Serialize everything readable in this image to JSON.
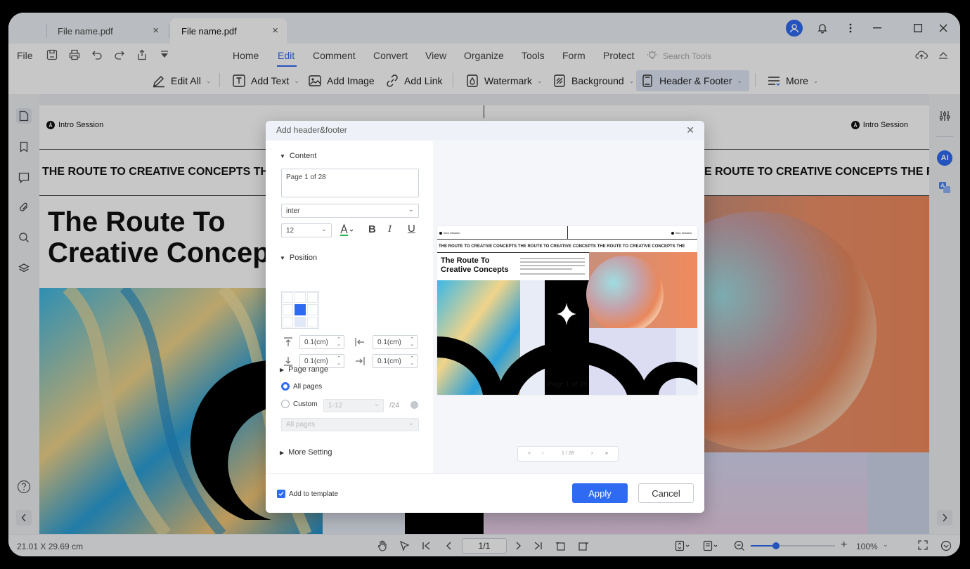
{
  "tabs": [
    {
      "title": "File name.pdf"
    },
    {
      "title": "File name.pdf"
    }
  ],
  "menu": {
    "file": "File",
    "items": [
      "Home",
      "Edit",
      "Comment",
      "Convert",
      "View",
      "Organize",
      "Tools",
      "Form",
      "Protect"
    ],
    "search_placeholder": "Search Tools"
  },
  "toolbar": {
    "edit_all": "Edit All",
    "add_text": "Add Text",
    "add_image": "Add Image",
    "add_link": "Add Link",
    "watermark": "Watermark",
    "background": "Background",
    "header_footer": "Header & Footer",
    "more": "More"
  },
  "doc": {
    "header_label": "Intro Session",
    "marquee": "THE ROUTE TO CREATIVE CONCEPTS THE ROUTE TO CREATIVE CONCEPTS",
    "marquee_right": "E ROUTE TO CREATIVE CONCEPTS THE R",
    "title_line1": "The Route To",
    "title_line2": "Creative Concep"
  },
  "dialog": {
    "title": "Add header&footer",
    "content_label": "Content",
    "content_text": "Page 1 of 28",
    "font": "inter",
    "font_size": "12",
    "position_label": "Position",
    "margin_top": "0.1(cm)",
    "margin_left": "0.1(cm)",
    "margin_bottom": "0.1(cm)",
    "margin_right": "0.1(cm)",
    "page_range_label": "Page range",
    "all_pages": "All pages",
    "custom": "Custom",
    "custom_range": "1-12",
    "total_pages": "/24",
    "subset": "All pages",
    "more_setting": "More Setting",
    "add_to_template": "Add to template",
    "apply": "Apply",
    "cancel": "Cancel",
    "preview": {
      "header_label": "Intro Session",
      "marquee": "THE ROUTE TO CREATIVE CONCEPTS THE ROUTE TO CREATIVE CONCEPTS THE ROUTE TO CREATIVE CONCEPTS THE",
      "title": "The Route To Creative Concepts",
      "footer_text": "Page 1 of 28",
      "pager": "1 / 28"
    }
  },
  "status": {
    "dimensions": "21.01 X 29.69 cm",
    "page_indicator": "1/1",
    "zoom": "100%",
    "zoom_level": 0.3
  },
  "colors": {
    "accent": "#2f6bf2"
  }
}
